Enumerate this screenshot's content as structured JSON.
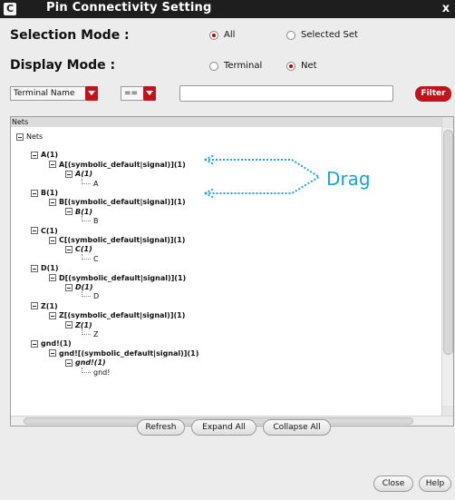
{
  "window": {
    "title": "Pin Connectivity Setting",
    "app_icon": "C",
    "close_glyph": "x"
  },
  "selection_mode": {
    "label": "Selection Mode :",
    "options": [
      {
        "label": "All",
        "selected": true
      },
      {
        "label": "Selected Set",
        "selected": false
      }
    ]
  },
  "display_mode": {
    "label": "Display Mode :",
    "options": [
      {
        "label": "Terminal",
        "selected": false
      },
      {
        "label": "Net",
        "selected": true
      }
    ]
  },
  "filter": {
    "field_select": "Terminal Name",
    "operator_select": "==",
    "value": "",
    "button_label": "Filter"
  },
  "tree": {
    "header": "Nets",
    "root": "Nets",
    "nodes": [
      {
        "level": 1,
        "label": "A(1)",
        "style": "b",
        "kind": "box"
      },
      {
        "level": 2,
        "label": "A[(symbolic_default|signal)](1)",
        "style": "b",
        "kind": "box"
      },
      {
        "level": 3,
        "label": "A(1)",
        "style": "i",
        "kind": "box"
      },
      {
        "level": 4,
        "label": "A",
        "style": "n",
        "kind": "leaf"
      },
      {
        "level": 1,
        "label": "B(1)",
        "style": "b",
        "kind": "box"
      },
      {
        "level": 2,
        "label": "B[(symbolic_default|signal)](1)",
        "style": "b",
        "kind": "box"
      },
      {
        "level": 3,
        "label": "B(1)",
        "style": "i",
        "kind": "box"
      },
      {
        "level": 4,
        "label": "B",
        "style": "n",
        "kind": "leaf"
      },
      {
        "level": 1,
        "label": "C(1)",
        "style": "b",
        "kind": "box"
      },
      {
        "level": 2,
        "label": "C[(symbolic_default|signal)](1)",
        "style": "b",
        "kind": "box"
      },
      {
        "level": 3,
        "label": "C(1)",
        "style": "i",
        "kind": "box"
      },
      {
        "level": 4,
        "label": "C",
        "style": "n",
        "kind": "leaf"
      },
      {
        "level": 1,
        "label": "D(1)",
        "style": "b",
        "kind": "box"
      },
      {
        "level": 2,
        "label": "D[(symbolic_default|signal)](1)",
        "style": "b",
        "kind": "box"
      },
      {
        "level": 3,
        "label": "D(1)",
        "style": "i",
        "kind": "box"
      },
      {
        "level": 4,
        "label": "D",
        "style": "n",
        "kind": "leaf"
      },
      {
        "level": 1,
        "label": "Z(1)",
        "style": "b",
        "kind": "box"
      },
      {
        "level": 2,
        "label": "Z[(symbolic_default|signal)](1)",
        "style": "b",
        "kind": "box"
      },
      {
        "level": 3,
        "label": "Z(1)",
        "style": "i",
        "kind": "box"
      },
      {
        "level": 4,
        "label": "Z",
        "style": "n",
        "kind": "leaf"
      },
      {
        "level": 1,
        "label": "gnd!(1)",
        "style": "b",
        "kind": "box"
      },
      {
        "level": 2,
        "label": "gnd![(symbolic_default|signal)](1)",
        "style": "b",
        "kind": "box"
      },
      {
        "level": 3,
        "label": "gnd!(1)",
        "style": "i",
        "kind": "box"
      },
      {
        "level": 4,
        "label": "gnd!",
        "style": "n",
        "kind": "leaf"
      }
    ]
  },
  "annotation": {
    "drag_label": "Drag",
    "color": "#1aa3e0"
  },
  "actions": {
    "refresh": "Refresh",
    "expand_all": "Expand All",
    "collapse_all": "Collapse All",
    "close": "Close",
    "help": "Help"
  },
  "colors": {
    "accent": "#c0141c",
    "titlebar": "#1e1e1e",
    "background": "#ececec"
  }
}
